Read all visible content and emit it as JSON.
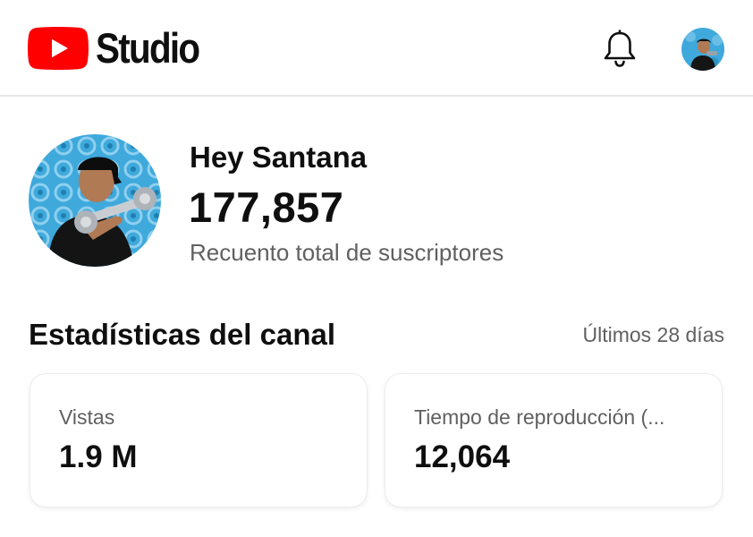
{
  "header": {
    "logo_text": "Studio",
    "brand_color": "#ff0000",
    "notifications_icon": "bell-icon",
    "account_icon": "avatar"
  },
  "channel": {
    "name": "Hey Santana",
    "subscriber_count": "177,857",
    "subscriber_label": "Recuento total de suscriptores"
  },
  "stats": {
    "title": "Estadísticas del canal",
    "period": "Últimos 28 días",
    "cards": [
      {
        "label": "Vistas",
        "value": "1.9 M"
      },
      {
        "label": "Tiempo de reproducción (...",
        "value": "12,064"
      }
    ]
  },
  "colors": {
    "text_primary": "#0f0f0f",
    "text_secondary": "#606060",
    "avatar_bg": "#3fa9dc"
  }
}
